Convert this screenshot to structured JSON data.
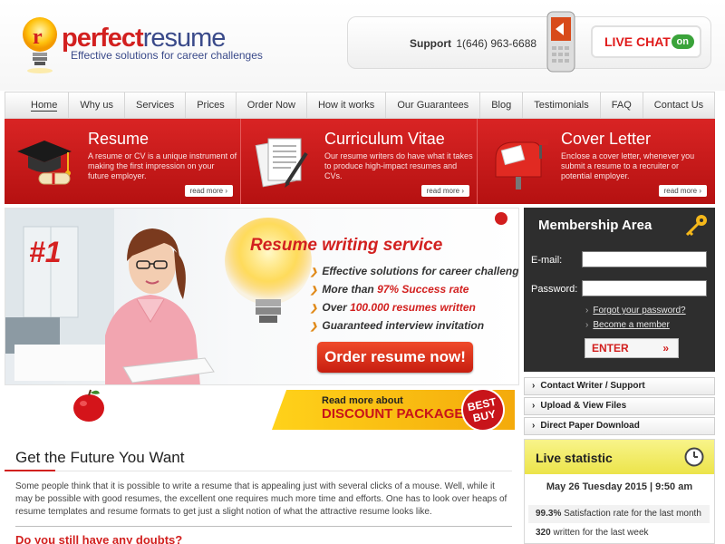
{
  "header": {
    "logo": {
      "word_part1": "perfect",
      "word_part2": "resume",
      "tagline": "Effective solutions for career challenges"
    },
    "support_label": "Support",
    "support_phone": "1(646) 963-6688",
    "live_chat": {
      "label": "LIVE CHAT",
      "status": "on"
    }
  },
  "nav": {
    "items": [
      {
        "label": "Home",
        "active": true
      },
      {
        "label": "Why us"
      },
      {
        "label": "Services"
      },
      {
        "label": "Prices"
      },
      {
        "label": "Order Now"
      },
      {
        "label": "How it works"
      },
      {
        "label": "Our Guarantees"
      },
      {
        "label": "Blog"
      },
      {
        "label": "Testimonials"
      },
      {
        "label": "FAQ"
      },
      {
        "label": "Contact Us"
      }
    ]
  },
  "features": [
    {
      "title": "Resume",
      "desc": "A resume or CV is a unique instrument of making the first impression on your future employer.",
      "more": "read more",
      "icon": "graduation-cap-icon"
    },
    {
      "title": "Curriculum Vitae",
      "desc": "Our resume writers do have what it takes to produce high-impact resumes and CVs.",
      "more": "read more",
      "icon": "documents-pen-icon"
    },
    {
      "title": "Cover Letter",
      "desc": "Enclose a cover letter, whenever you submit a resume to a recruiter or potential employer.",
      "more": "read more",
      "icon": "mailbox-icon"
    }
  ],
  "banner": {
    "rank": "#1",
    "title": "Resume writing service",
    "bullets": [
      {
        "pre": "Effective solutions for career challenges",
        "hl": "",
        "post": ""
      },
      {
        "pre": "More than ",
        "hl": "97% Success rate",
        "post": ""
      },
      {
        "pre": "Over ",
        "hl": "100.000 resumes written",
        "post": ""
      },
      {
        "pre": "Guaranteed interview invitation",
        "hl": "",
        "post": ""
      }
    ],
    "order_button": "Order resume now!"
  },
  "discount": {
    "line1": "Read more about",
    "line2": "DISCOUNT PACKAGE",
    "badge_line1": "BEST",
    "badge_line2": "BUY"
  },
  "membership": {
    "title": "Membership Area",
    "email_label": "E-mail:",
    "password_label": "Password:",
    "email_value": "",
    "password_value": "",
    "forgot_link": "Forgot your password?",
    "become_link": "Become a member",
    "enter_button": "ENTER",
    "enter_arrow": "»"
  },
  "side_links": [
    "Contact Writer / Support",
    "Upload & View Files",
    "Direct Paper Download"
  ],
  "stats": {
    "title": "Live statistic",
    "date": "May 26 Tuesday 2015 | 9:50 am",
    "rows": [
      {
        "value": "99.3%",
        "text": "Satisfaction rate for the last month"
      },
      {
        "value": "320",
        "text": "written for the last week"
      }
    ]
  },
  "content": {
    "title": "Get the Future You Want",
    "paragraph": "Some people think that it is possible to write a resume that is appealing just with several clicks of a mouse. Well, while it may be possible with good resumes, the excellent one requires much more time and efforts. One has to look over heaps of resume templates and resume formats to get just a slight notion of what the attractive resume looks like.",
    "subheading": "Do you still have any doubts?"
  },
  "colors": {
    "brand_red": "#d2201f",
    "brand_blue": "#3a4a8a",
    "stat_yellow": "#ece44a",
    "sidebar_dark": "#2e2e2e"
  }
}
